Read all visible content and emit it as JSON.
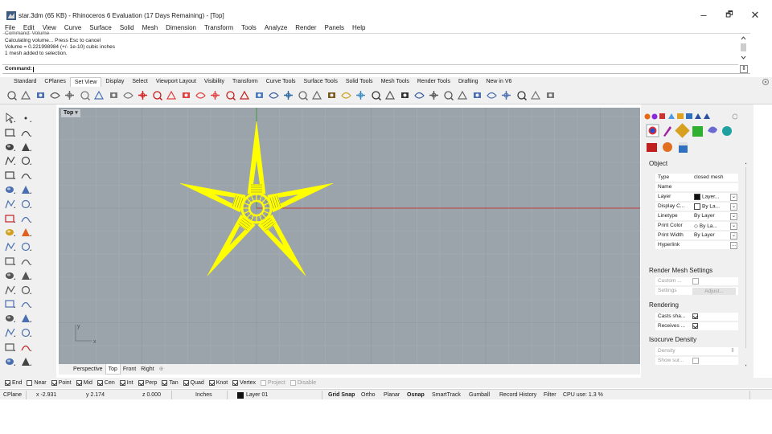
{
  "window": {
    "title": "star.3dm (65 KB) - Rhinoceros 6 Evaluation (17 Days Remaining) - [Top]",
    "minimize_glyph": "–",
    "maximize_glyph": "🗗",
    "close_glyph": "✕"
  },
  "menu": [
    "File",
    "Edit",
    "View",
    "Curve",
    "Surface",
    "Solid",
    "Mesh",
    "Dimension",
    "Transform",
    "Tools",
    "Analyze",
    "Render",
    "Panels",
    "Help"
  ],
  "command": {
    "history": [
      "Command: Volume",
      "Calculating volume... Press Esc to cancel",
      "Volume = 0.221998984 (+/- 1e-10) cubic inches",
      "1 mesh added to selection."
    ],
    "prompt": "Command:"
  },
  "toolbar_tabs": [
    "Standard",
    "CPlanes",
    "Set View",
    "Display",
    "Select",
    "Viewport Layout",
    "Visibility",
    "Transform",
    "Curve Tools",
    "Surface Tools",
    "Solid Tools",
    "Mesh Tools",
    "Render Tools",
    "Drafting",
    "New in V6"
  ],
  "toolbar_active_tab": "Set View",
  "toolbar_icons": [
    "pan-icon",
    "rotate-icon",
    "zoom-dynamic-icon",
    "zoom-window-icon",
    "zoom-extents-icon",
    "zoom-selected-icon",
    "zoom-target-icon",
    "undo-view-icon",
    "redo-view-icon",
    "named-view-red-icon",
    "named-view-red-2-icon",
    "camera-icon",
    "camera-2-icon",
    "camera-3-icon",
    "camera-4-icon",
    "camera-5-icon",
    "set-view-icon",
    "camera-box-icon",
    "named-views-icon",
    "named-cplanes-icon",
    "zoom-in-icon",
    "zoom-out-icon",
    "world-icon",
    "sun-icon",
    "target-icon",
    "plan-view-icon",
    "snapshot-icon",
    "perspective-icon",
    "tilt-icon",
    "dolly-icon",
    "lens-icon",
    "walk-icon",
    "fly-icon",
    "swivel-icon",
    "horizon-icon",
    "person-icon",
    "pivot-icon",
    "settings-icon"
  ],
  "viewport": {
    "name": "Top",
    "tabs": [
      "Perspective",
      "Top",
      "Front",
      "Right"
    ],
    "active_tab": "Top",
    "add_glyph": "⊕",
    "axis_x": "x",
    "axis_y": "y"
  },
  "panel": {
    "section_object": "Object",
    "properties": [
      {
        "label": "Type",
        "value": "closed mesh",
        "dropdown": false
      },
      {
        "label": "Name",
        "value": "",
        "dropdown": false
      },
      {
        "label": "Layer",
        "value": "Layer...",
        "dropdown": true,
        "swatch": "#111111"
      },
      {
        "label": "Display C...",
        "value": "By La...",
        "dropdown": true,
        "swatch": "#ffffff"
      },
      {
        "label": "Linetype",
        "value": "By Layer",
        "dropdown": true
      },
      {
        "label": "Print Color",
        "value": "◇ By La...",
        "dropdown": true
      },
      {
        "label": "Print Width",
        "value": "By Layer",
        "dropdown": true
      },
      {
        "label": "Hyperlink",
        "value": "",
        "button": "..."
      }
    ],
    "section_render_mesh": "Render Mesh Settings",
    "custom_label": "Custom ...",
    "settings_label": "Settings",
    "adjust_button": "Adjust...",
    "section_rendering": "Rendering",
    "casts_shadows": "Casts sha...",
    "receives_shadows": "Receives ...",
    "section_isocurve": "Isocurve Density",
    "density_label": "Density",
    "show_surface_label": "Show sur..."
  },
  "osnaps": [
    {
      "label": "End",
      "checked": true
    },
    {
      "label": "Near",
      "checked": false
    },
    {
      "label": "Point",
      "checked": true
    },
    {
      "label": "Mid",
      "checked": true
    },
    {
      "label": "Cen",
      "checked": true
    },
    {
      "label": "Int",
      "checked": true
    },
    {
      "label": "Perp",
      "checked": true
    },
    {
      "label": "Tan",
      "checked": true
    },
    {
      "label": "Quad",
      "checked": true
    },
    {
      "label": "Knot",
      "checked": true
    },
    {
      "label": "Vertex",
      "checked": true
    },
    {
      "label": "Project",
      "checked": false,
      "disabled": true
    },
    {
      "label": "Disable",
      "checked": false,
      "disabled": true
    }
  ],
  "status": {
    "cplane": "CPlane",
    "x": "x -2.931",
    "y": "y 2.174",
    "z": "z 0.000",
    "units": "Inches",
    "layer": "Layer 01",
    "grid_snap": "Grid Snap",
    "ortho": "Ortho",
    "planar": "Planar",
    "osnap": "Osnap",
    "smarttrack": "SmartTrack",
    "gumball": "Gumball",
    "record_history": "Record History",
    "filter": "Filter",
    "cpu": "CPU use: 1.3 %"
  },
  "colors": {
    "viewport_bg": "#9ba3ab",
    "grid_minor": "#a6aeb6",
    "grid_major": "#8d959c",
    "axis_x": "#c23b3b",
    "axis_y": "#3a9a3a",
    "selection": "#ffff00"
  }
}
